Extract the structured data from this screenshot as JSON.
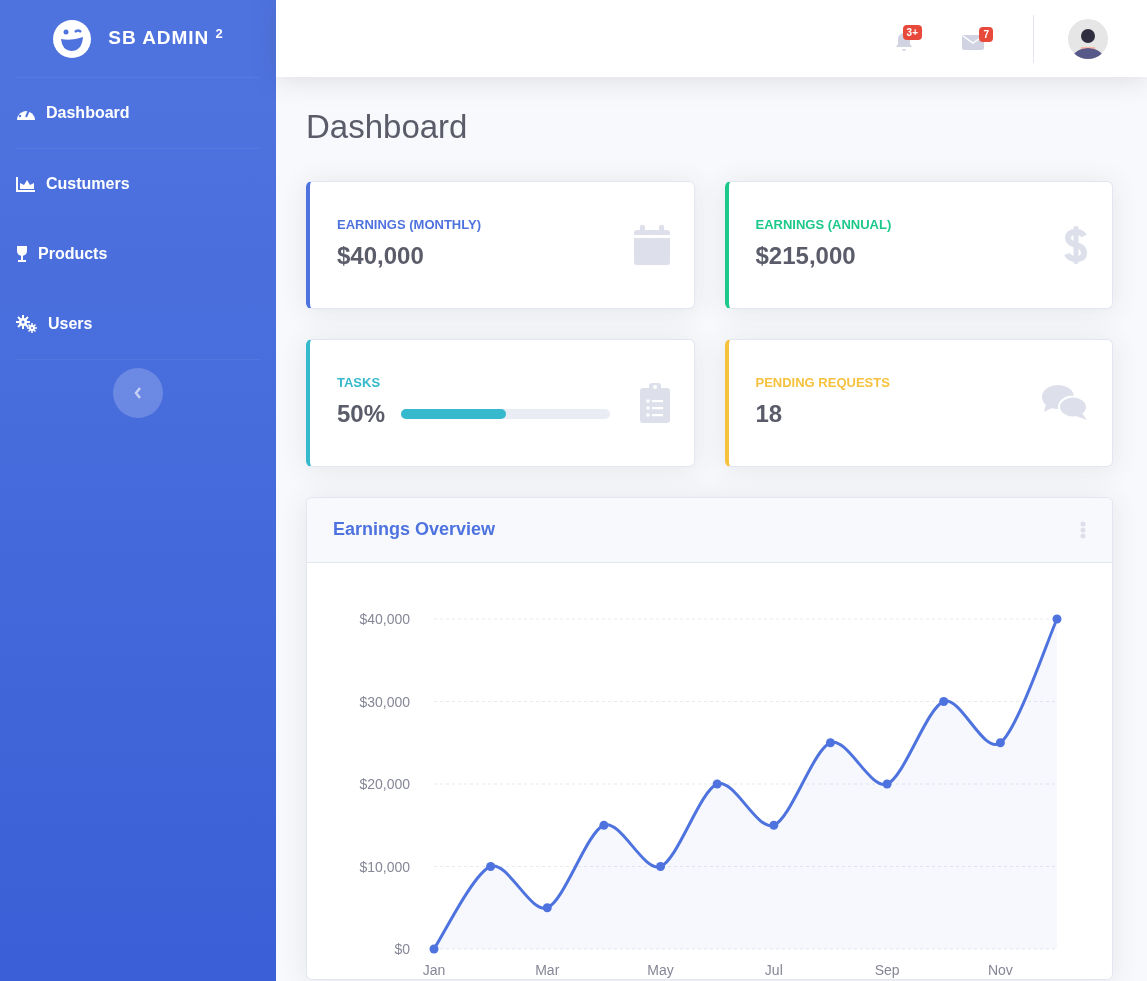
{
  "sidebar": {
    "brand": "SB ADMIN",
    "brand_sup": "2",
    "items": [
      {
        "label": "Dashboard"
      },
      {
        "label": "Custumers"
      },
      {
        "label": "Products"
      },
      {
        "label": "Users"
      }
    ]
  },
  "topbar": {
    "alerts_badge": "3+",
    "messages_badge": "7"
  },
  "page_title": "Dashboard",
  "stat_cards": [
    {
      "kind": "value",
      "title": "EARNINGS (MONTHLY)",
      "value": "$40,000",
      "color": "#4e73df"
    },
    {
      "kind": "value",
      "title": "EARNINGS (ANNUAL)",
      "value": "$215,000",
      "color": "#1cc88a"
    },
    {
      "kind": "progress",
      "title": "TASKS",
      "value": "50%",
      "level": 0.5,
      "color": "#36b9cc"
    },
    {
      "kind": "value",
      "title": "PENDING REQUESTS",
      "value": "18",
      "color": "#f6c23e"
    }
  ],
  "earnings_card": {
    "title": "Earnings Overview",
    "chart_data": {
      "type": "area",
      "grid": true,
      "categories": [
        "Jan",
        null,
        "Mar",
        null,
        "May",
        null,
        "Jul",
        null,
        "Sep",
        null,
        "Nov",
        null
      ],
      "series": [
        {
          "color": "#4e73df",
          "values": [
            0,
            10000,
            5000,
            15000,
            10000,
            20000,
            15000,
            25000,
            20000,
            30000,
            25000,
            40000
          ]
        }
      ],
      "ylim": [
        0,
        40000
      ],
      "yticks": [
        {
          "value": 0,
          "label": "$0"
        },
        {
          "value": 10000,
          "label": "$10,000"
        },
        {
          "value": 20000,
          "label": "$20,000"
        },
        {
          "value": 30000,
          "label": "$30,000"
        },
        {
          "value": 40000,
          "label": "$40,000"
        }
      ]
    }
  }
}
